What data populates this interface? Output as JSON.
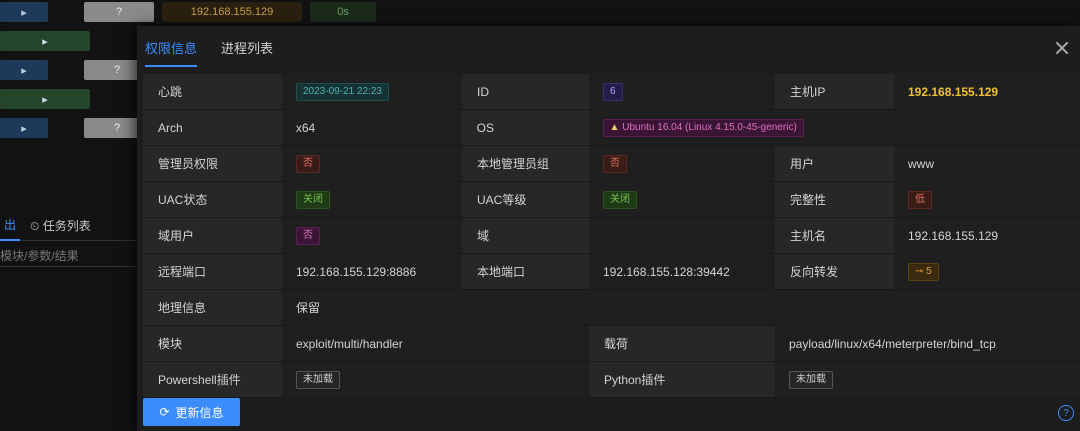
{
  "background": {
    "ip": "192.168.155.129",
    "duration": "0s",
    "unknown": "?",
    "tabs": [
      "出",
      "任务列表"
    ],
    "filter_placeholder": "模块/参数/结果"
  },
  "modal": {
    "tabs": [
      {
        "label": "权限信息",
        "active": true
      },
      {
        "label": "进程列表",
        "active": false
      }
    ],
    "rows": {
      "heartbeat": {
        "label": "心跳",
        "value": "2023-09-21 22:23"
      },
      "id": {
        "label": "ID",
        "value": "6"
      },
      "host_ip": {
        "label": "主机IP",
        "value": "192.168.155.129"
      },
      "arch": {
        "label": "Arch",
        "value": "x64"
      },
      "os": {
        "label": "OS",
        "value": "Ubuntu 16.04 (Linux 4.15.0-45-generic)"
      },
      "admin": {
        "label": "管理员权限",
        "value": "否"
      },
      "local_admin_group": {
        "label": "本地管理员组",
        "value": "否"
      },
      "user": {
        "label": "用户",
        "value": "www"
      },
      "uac_status": {
        "label": "UAC状态",
        "value": "关闭"
      },
      "uac_level": {
        "label": "UAC等级",
        "value": "关闭"
      },
      "integrity": {
        "label": "完整性",
        "value": "低"
      },
      "domain_user": {
        "label": "域用户",
        "value": "否"
      },
      "domain": {
        "label": "域",
        "value": ""
      },
      "hostname": {
        "label": "主机名",
        "value": "192.168.155.129"
      },
      "remote_port": {
        "label": "远程端口",
        "value": "192.168.155.129:8886"
      },
      "local_port": {
        "label": "本地端口",
        "value": "192.168.155.128:39442"
      },
      "reverse_forward": {
        "label": "反向转发",
        "value": "5"
      },
      "geo": {
        "label": "地理信息",
        "value": "保留"
      },
      "module": {
        "label": "模块",
        "value": "exploit/multi/handler"
      },
      "payload": {
        "label": "载荷",
        "value": "payload/linux/x64/meterpreter/bind_tcp"
      },
      "powershell_plugin": {
        "label": "Powershell插件",
        "value": "未加载"
      },
      "python_plugin": {
        "label": "Python插件",
        "value": "未加载"
      }
    },
    "update_button": "更新信息",
    "help": "?"
  },
  "colors": {
    "accent": "#3b8cff",
    "ip_highlight": "#f0c030"
  }
}
